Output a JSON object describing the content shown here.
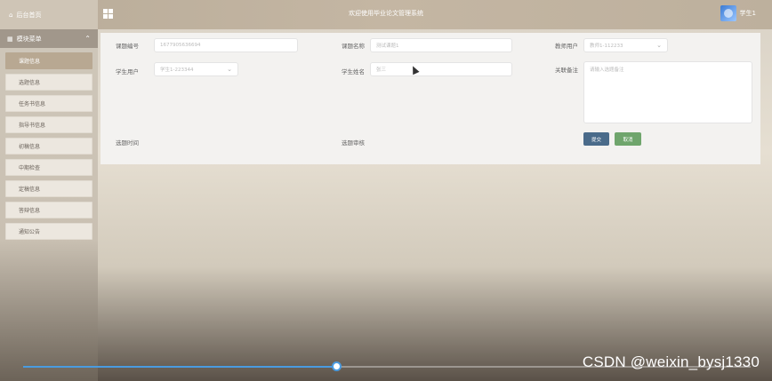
{
  "topbar": {
    "home_label": "后台首页",
    "title": "欢迎使用毕业论文管理系统",
    "user_name": "学生1"
  },
  "sidebar": {
    "menu_title": "模块菜单",
    "items": [
      {
        "label": "课题信息",
        "active": true
      },
      {
        "label": "选题信息",
        "active": false
      },
      {
        "label": "任务书信息",
        "active": false
      },
      {
        "label": "指导书信息",
        "active": false
      },
      {
        "label": "初稿信息",
        "active": false
      },
      {
        "label": "中期检查",
        "active": false
      },
      {
        "label": "定稿信息",
        "active": false
      },
      {
        "label": "答辩信息",
        "active": false
      },
      {
        "label": "通知公告",
        "active": false
      }
    ]
  },
  "form": {
    "topic_no_label": "课题编号",
    "topic_no_value": "1677905636694",
    "topic_name_label": "课题名称",
    "topic_name_value": "测试课题1",
    "teacher_account_label": "教师用户",
    "teacher_account_value": "教师1-112233",
    "student_account_label": "学生用户",
    "student_account_value": "学生1-223344",
    "student_name_label": "学生姓名",
    "student_name_value": "张三",
    "remark_label": "关联备注",
    "remark_placeholder": "请输入选题备注",
    "select_time_label": "选题时间",
    "select_review_label": "选题审核",
    "submit_label": "提交",
    "cancel_label": "取消"
  },
  "video": {
    "progress": 0.43
  },
  "watermark": "CSDN @weixin_bysj1330"
}
